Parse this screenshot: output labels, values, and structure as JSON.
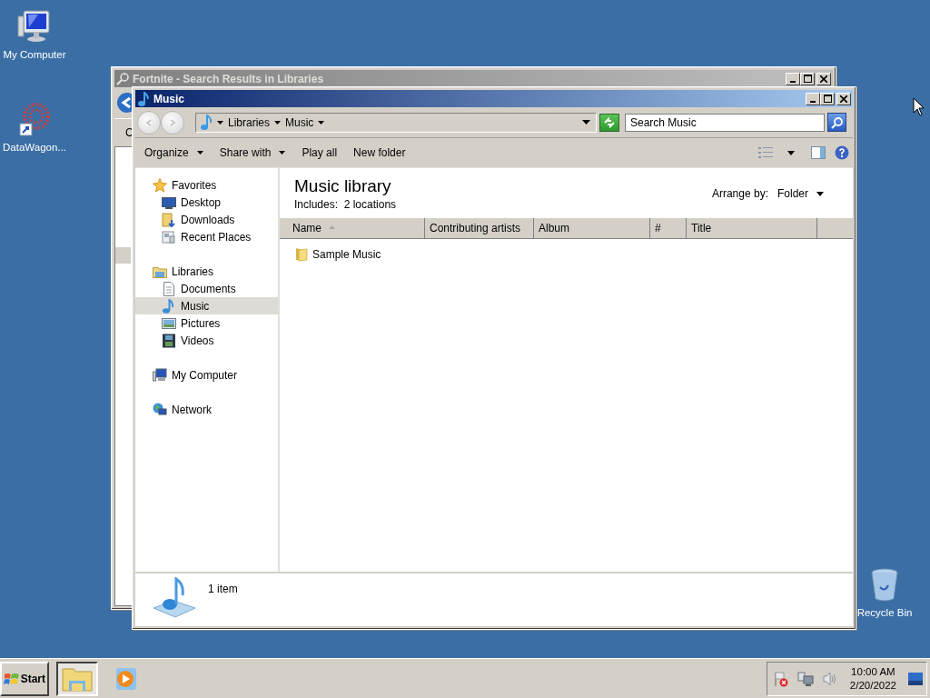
{
  "desktop_icons": [
    {
      "label": "My Computer",
      "kind": "computer"
    },
    {
      "label": "DataWagon...",
      "kind": "app"
    },
    {
      "label": "Recycle Bin",
      "kind": "recycle"
    }
  ],
  "back_window": {
    "title": "Fortnite - Search Results in Libraries",
    "partial_text": "C"
  },
  "window": {
    "title": "Music",
    "breadcrumb": [
      "Libraries",
      "Music"
    ],
    "search": {
      "placeholder": "Search Music"
    },
    "toolbar": [
      {
        "label": "Organize",
        "dropdown": true
      },
      {
        "label": "Share with",
        "dropdown": true
      },
      {
        "label": "Play all",
        "dropdown": false
      },
      {
        "label": "New folder",
        "dropdown": false
      }
    ],
    "nav": [
      {
        "label": "Favorites",
        "kind": "star",
        "selected": false,
        "children": [
          {
            "label": "Desktop",
            "kind": "desktop",
            "selected": false
          },
          {
            "label": "Downloads",
            "kind": "downloads",
            "selected": false
          },
          {
            "label": "Recent Places",
            "kind": "recent",
            "selected": false
          }
        ]
      },
      {
        "label": "Libraries",
        "kind": "libraries",
        "selected": false,
        "children": [
          {
            "label": "Documents",
            "kind": "documents",
            "selected": false
          },
          {
            "label": "Music",
            "kind": "music",
            "selected": true
          },
          {
            "label": "Pictures",
            "kind": "pictures",
            "selected": false
          },
          {
            "label": "Videos",
            "kind": "videos",
            "selected": false
          }
        ]
      },
      {
        "label": "My Computer",
        "kind": "computer",
        "selected": false
      },
      {
        "label": "Network",
        "kind": "network",
        "selected": false
      }
    ],
    "library": {
      "title": "Music library",
      "subtitle": "Includes:  2 locations",
      "arrange_label": "Arrange by:",
      "arrange_value": "Folder"
    },
    "columns": [
      {
        "label": "Name",
        "sorted": true
      },
      {
        "label": "Contributing artists",
        "sorted": false
      },
      {
        "label": "Album",
        "sorted": false
      },
      {
        "label": "#",
        "sorted": false
      },
      {
        "label": "Title",
        "sorted": false
      }
    ],
    "items": [
      {
        "name": "Sample Music",
        "kind": "folder"
      }
    ],
    "status": "1 item"
  },
  "taskbar": {
    "start": "Start",
    "buttons": [
      {
        "kind": "explorer",
        "selected": true
      },
      {
        "kind": "media",
        "selected": false
      }
    ],
    "clock": {
      "time": "10:00 AM",
      "date": "2/20/2022"
    }
  }
}
